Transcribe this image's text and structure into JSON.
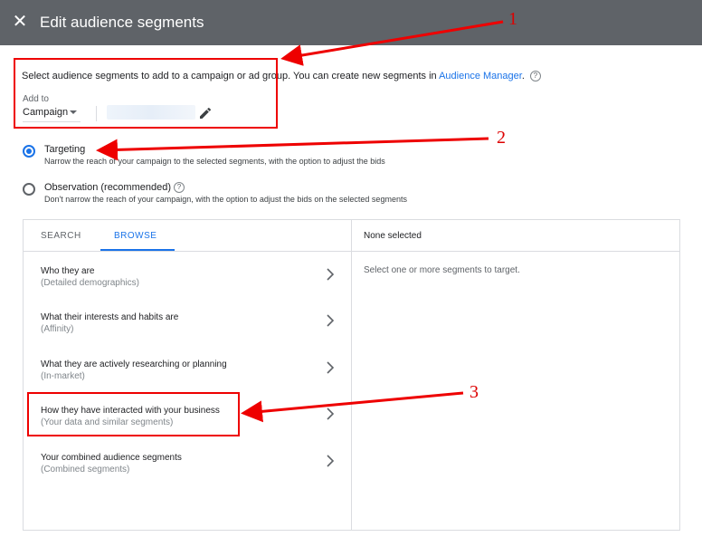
{
  "header": {
    "title": "Edit audience segments",
    "close_icon": "close-icon"
  },
  "intro": {
    "text": "Select audience segments to add to a campaign or ad group. You can create new segments in ",
    "link": "Audience Manager",
    "suffix": "."
  },
  "add_to": {
    "label": "Add to",
    "value": "Campaign"
  },
  "radios": [
    {
      "title": "Targeting",
      "desc": "Narrow the reach of your campaign to the selected segments, with the option to adjust the bids",
      "selected": true
    },
    {
      "title": "Observation (recommended)",
      "desc": "Don't narrow the reach of your campaign, with the option to adjust the bids on the selected segments",
      "selected": false
    }
  ],
  "tabs": {
    "search": "SEARCH",
    "browse": "BROWSE"
  },
  "categories": [
    {
      "title": "Who they are",
      "sub": "(Detailed demographics)"
    },
    {
      "title": "What their interests and habits are",
      "sub": "(Affinity)"
    },
    {
      "title": "What they are actively researching or planning",
      "sub": "(In-market)"
    },
    {
      "title": "How they have interacted with your business",
      "sub": "(Your data and similar segments)"
    },
    {
      "title": "Your combined audience segments",
      "sub": "(Combined segments)"
    }
  ],
  "selection": {
    "header": "None selected",
    "hint": "Select one or more segments to target."
  },
  "annotations": {
    "one": "1",
    "two": "2",
    "three": "3"
  },
  "colors": {
    "header_bg": "#5f6368",
    "accent": "#1a73e8",
    "annotation": "#e00000"
  }
}
